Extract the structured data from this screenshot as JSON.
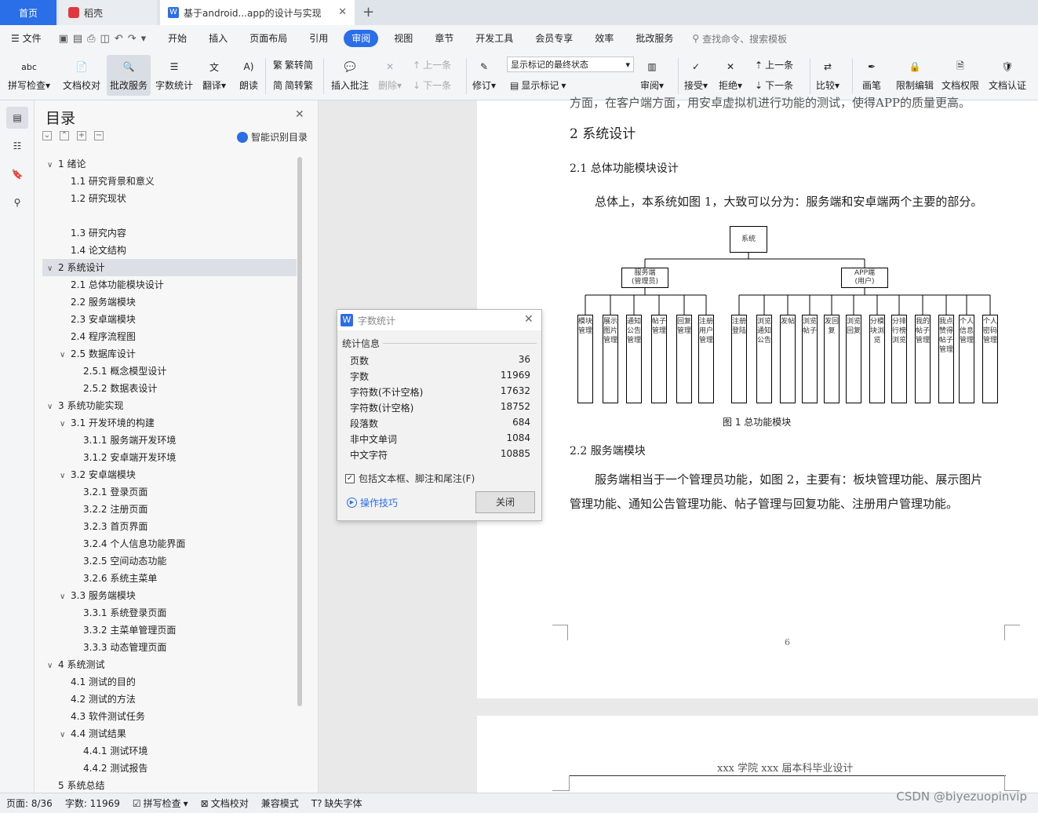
{
  "tabs": {
    "home": "首页",
    "daoke": "稻壳",
    "doc": "基于android...app的设计与实现"
  },
  "menus": [
    "文件",
    "开始",
    "插入",
    "页面布局",
    "引用",
    "审阅",
    "视图",
    "章节",
    "开发工具",
    "会员专享",
    "效率",
    "批改服务"
  ],
  "search_placeholder": "查找命令、搜索模板",
  "ribbon": {
    "spell": "拼写检查",
    "proof": "文档校对",
    "review_service": "批改服务",
    "wordcount": "字数统计",
    "translate": "翻译",
    "read": "朗读",
    "trad": "繁转简",
    "simp": "简转繁",
    "insert_comment": "插入批注",
    "delete": "删除",
    "prev": "上一条",
    "next": "下一条",
    "track": "修订",
    "markup_state": "显示标记的最终状态",
    "show_markup": "显示标记",
    "reviewer": "审阅",
    "accept": "接受",
    "reject": "拒绝",
    "prev2": "上一条",
    "next2": "下一条",
    "compare": "比较",
    "pen": "画笔",
    "restrict": "限制编辑",
    "permission": "文档权限",
    "certify": "文档认证",
    "abc": "abc"
  },
  "toc": {
    "title": "目录",
    "smart": "智能识别目录",
    "items": [
      "1 绪论",
      "1.1 研究背景和意义",
      "1.2 研究现状",
      "1.3 研究内容",
      "1.4 论文结构",
      "2 系统设计",
      "2.1 总体功能模块设计",
      "2.2 服务端模块",
      "2.3 安卓端模块",
      "2.4 程序流程图",
      "2.5 数据库设计",
      "2.5.1 概念模型设计",
      "2.5.2 数据表设计",
      "3 系统功能实现",
      "3.1 开发环境的构建",
      "3.1.1 服务端开发环境",
      "3.1.2 安卓端开发环境",
      "3.2 安卓端模块",
      "3.2.1 登录页面",
      "3.2.2 注册页面",
      "3.2.3 首页界面",
      "3.2.4 个人信息功能界面",
      "3.2.5 空间动态功能",
      "3.2.6 系统主菜单",
      "3.3 服务端模块",
      "3.3.1 系统登录页面",
      "3.3.2 主菜单管理页面",
      "3.3.3 动态管理页面",
      "4 系统测试",
      "4.1 测试的目的",
      "4.2 测试的方法",
      "4.3 软件测试任务",
      "4.4 测试结果",
      "4.4.1 测试环境",
      "4.4.2 测试报告",
      "5 系统总结"
    ]
  },
  "dialog": {
    "title": "字数统计",
    "section": "统计信息",
    "rows": [
      {
        "k": "页数",
        "v": "36"
      },
      {
        "k": "字数",
        "v": "11969"
      },
      {
        "k": "字符数(不计空格)",
        "v": "17632"
      },
      {
        "k": "字符数(计空格)",
        "v": "18752"
      },
      {
        "k": "段落数",
        "v": "684"
      },
      {
        "k": "非中文单词",
        "v": "1084"
      },
      {
        "k": "中文字符",
        "v": "10885"
      }
    ],
    "checkbox": "包括文本框、脚注和尾注(F)",
    "tips": "操作技巧",
    "close": "关闭"
  },
  "doc": {
    "top_cut": "方面，在客户端方面，用安卓虚拟机进行功能的测试，使得APP的质量更高。",
    "h2": "2  系统设计",
    "h21": "2.1  总体功能模块设计",
    "p1": "总体上，本系统如图 1，大致可以分为：服务端和安卓端两个主要的部分。",
    "fig_caption": "图 1 总功能模块",
    "h22": "2.2  服务端模块",
    "p2a": "服务端相当于一个管理员功能，如图 2，主要有：板块管理功能、展示图片",
    "p2b": "管理功能、通知公告管理功能、帖子管理与回复功能、注册用户管理功能。",
    "page_no": "6",
    "header2": "xxx 学院 xxx 届本科毕业设计"
  },
  "diagram": {
    "root": "系统",
    "left": "服务端\n(管理员)",
    "right": "APP端\n(用户)",
    "left_children": [
      "模块管理",
      "展示图片管理",
      "通知公告管理",
      "帖子管理",
      "回复管理",
      "注册用户管理"
    ],
    "right_children": [
      "注册登陆",
      "浏览通知公告",
      "发帖",
      "浏览帖子",
      "发回复",
      "浏览回复",
      "分模块浏览",
      "分排行榜浏览",
      "我的帖子管理",
      "我点赞得帖子管理",
      "个人信息管理",
      "个人密码管理"
    ]
  },
  "status": {
    "page": "页面: 8/36",
    "words": "字数: 11969",
    "spell": "拼写检查",
    "proof": "文档校对",
    "compat": "兼容模式",
    "missing_font": "缺失字体"
  },
  "watermark": "CSDN @biyezuopinvip"
}
